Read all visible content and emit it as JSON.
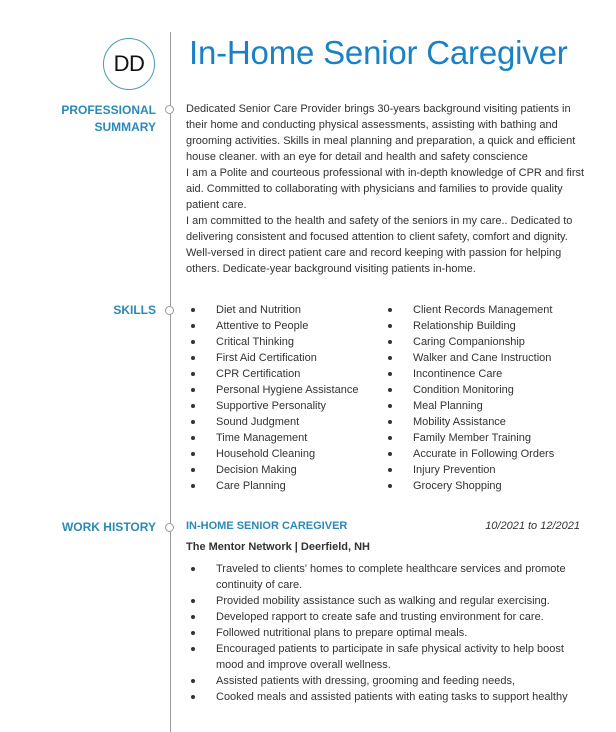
{
  "header": {
    "monogram": "DD",
    "title": "In-Home Senior Caregiver"
  },
  "colors": {
    "accent": "#1a82c4",
    "section_label": "#2a8ab5",
    "text": "#333333",
    "timeline": "#9a9a9a"
  },
  "sections": {
    "summary": {
      "label_line1": "PROFESSIONAL",
      "label_line2": "SUMMARY",
      "paragraphs": [
        "Dedicated Senior Care Provider brings 30-years background visiting patients in their home and conducting physical assessments, assisting with bathing and grooming activities. Skills in meal planning and preparation, a quick and efficient house cleaner. with an eye for detail and health and safety conscience",
        "I am a Polite and courteous professional with in-depth knowledge of CPR and first aid. Committed to collaborating with physicians and families to provide quality patient care.",
        "I am committed to the health and safety of the seniors in my care.. Dedicated to delivering consistent and focused attention to client safety, comfort and dignity. Well-versed in direct patient care and record keeping with passion for helping others. Dedicate-year background visiting patients in-home."
      ]
    },
    "skills": {
      "label": "SKILLS",
      "left": [
        "Diet and Nutrition",
        "Attentive to People",
        "Critical Thinking",
        "First Aid Certification",
        "CPR Certification",
        "Personal Hygiene Assistance",
        "Supportive Personality",
        "Sound Judgment",
        "Time Management",
        "Household Cleaning",
        "Decision Making",
        "Care Planning"
      ],
      "right": [
        "Client Records Management",
        "Relationship Building",
        "Caring Companionship",
        "Walker and Cane Instruction",
        "Incontinence Care",
        "Condition Monitoring",
        "Meal Planning",
        "Mobility Assistance",
        "Family Member Training",
        "Accurate in Following Orders",
        "Injury Prevention",
        "Grocery Shopping"
      ]
    },
    "work_history": {
      "label": "WORK HISTORY",
      "jobs": [
        {
          "title": "IN-HOME SENIOR CAREGIVER",
          "dates": "10/2021 to 12/2021",
          "company": "The Mentor Network | Deerfield, NH",
          "duties": [
            "Traveled to clients' homes to complete healthcare services and promote continuity of care.",
            "Provided mobility assistance such as walking and regular exercising.",
            "Developed rapport to create safe and trusting environment for care.",
            "Followed nutritional plans to prepare optimal meals.",
            "Encouraged patients to participate in safe physical activity to help boost mood and improve overall wellness.",
            "Assisted patients with dressing, grooming and feeding needs,",
            "Cooked meals and assisted patients with eating tasks to support healthy"
          ]
        }
      ]
    }
  }
}
